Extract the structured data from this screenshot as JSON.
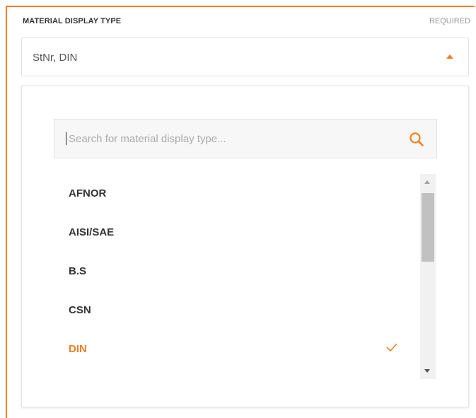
{
  "field": {
    "label": "MATERIAL DISPLAY TYPE",
    "required": "REQUIRED",
    "value": "StNr, DIN"
  },
  "search": {
    "placeholder": "Search for material display type...",
    "value": ""
  },
  "options": [
    {
      "label": "AFNOR",
      "selected": false
    },
    {
      "label": "AISI/SAE",
      "selected": false
    },
    {
      "label": "B.S",
      "selected": false
    },
    {
      "label": "CSN",
      "selected": false
    },
    {
      "label": "DIN",
      "selected": true
    }
  ],
  "icons": {
    "search": "search-icon",
    "caret": "caret-up-icon",
    "check": "check-icon"
  },
  "colors": {
    "accent": "#f07f22",
    "text": "#333333",
    "muted": "#9a9a9a"
  }
}
